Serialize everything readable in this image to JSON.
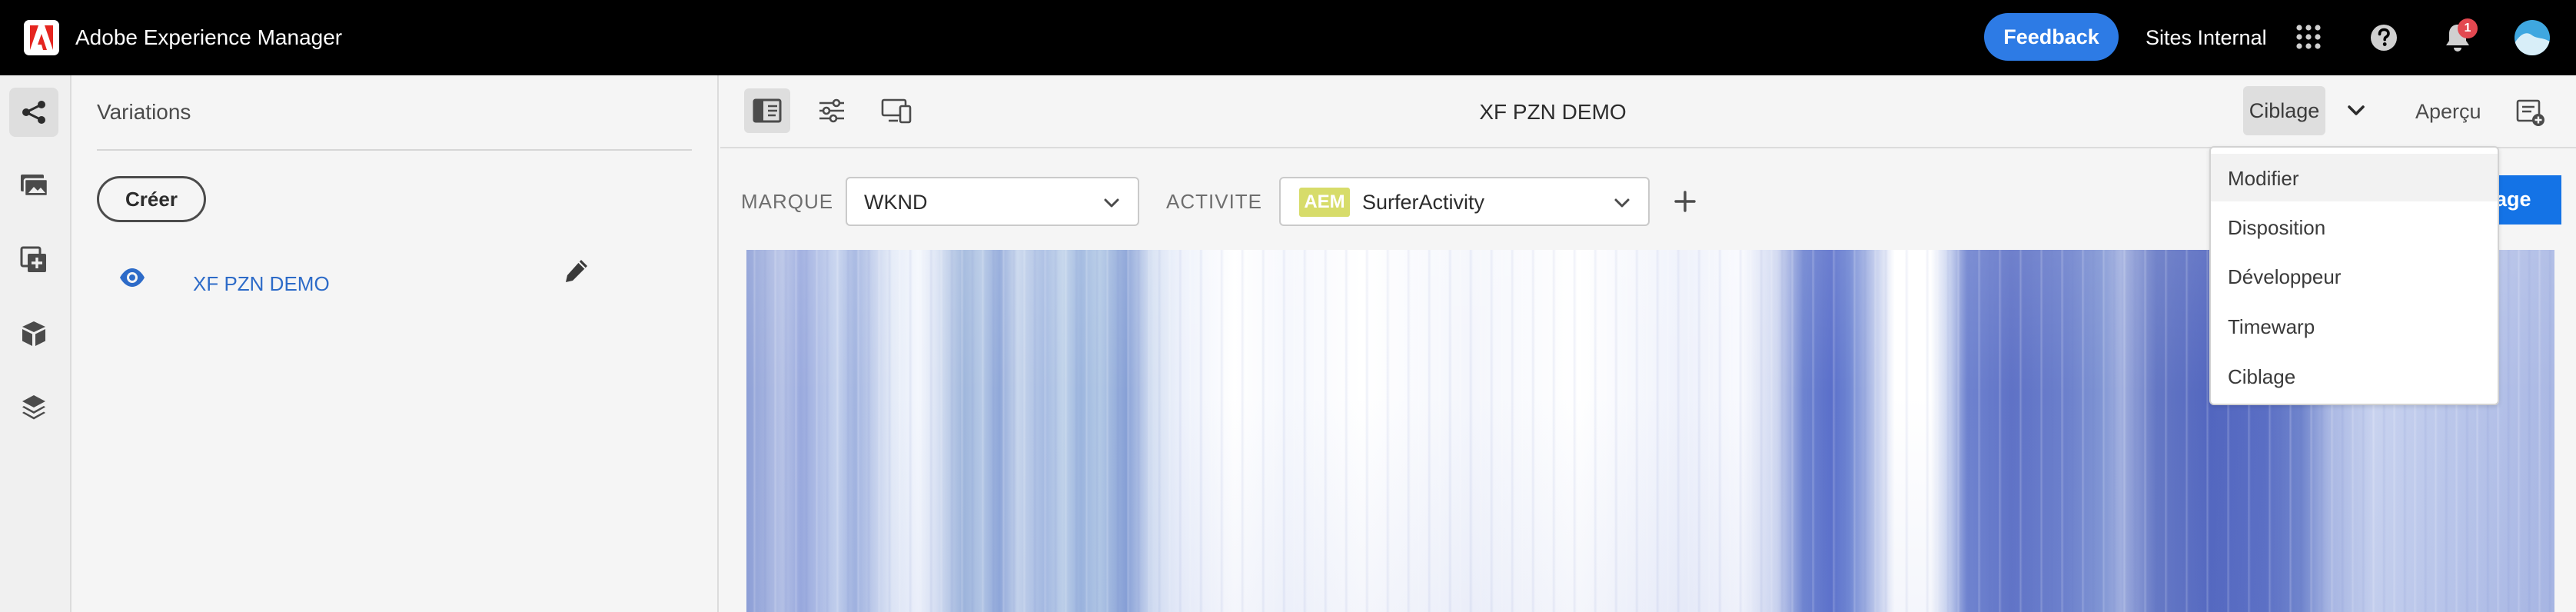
{
  "header": {
    "app_title": "Adobe Experience Manager",
    "feedback_label": "Feedback",
    "org_name": "Sites Internal",
    "notification_count": "1",
    "icons": [
      "adobe-logo",
      "apps-grid-icon",
      "help-icon",
      "bell-icon",
      "avatar"
    ],
    "colors": {
      "bar": "#000000",
      "feedback": "#2d7be5",
      "badge": "#e34850"
    }
  },
  "rail": {
    "items": [
      "share-icon",
      "assets-icon",
      "components-icon",
      "cube-icon",
      "layers-icon"
    ],
    "active": "share-icon"
  },
  "panel": {
    "title": "Variations",
    "create_label": "Créer",
    "variations": [
      {
        "name": "XF PZN DEMO",
        "icons": [
          "eye-icon",
          "pencil-icon"
        ]
      }
    ],
    "link_color": "#2d6bc8"
  },
  "editor": {
    "page_title": "XF PZN DEMO",
    "tools": [
      "side-panel-icon",
      "properties-icon",
      "emulator-icon"
    ],
    "mode_label": "Ciblage",
    "preview_label": "Aperçu"
  },
  "targeting": {
    "brand_label": "MARQUE",
    "brand_value": "WKND",
    "activity_label": "ACTIVITE",
    "activity_tag": "AEM",
    "activity_value": "SurferActivity",
    "blue_button_label": "age",
    "accent": "#1473e6"
  },
  "mode_menu": {
    "items": [
      "Modifier",
      "Disposition",
      "Développeur",
      "Timewarp",
      "Ciblage"
    ],
    "hovered": "Modifier"
  }
}
